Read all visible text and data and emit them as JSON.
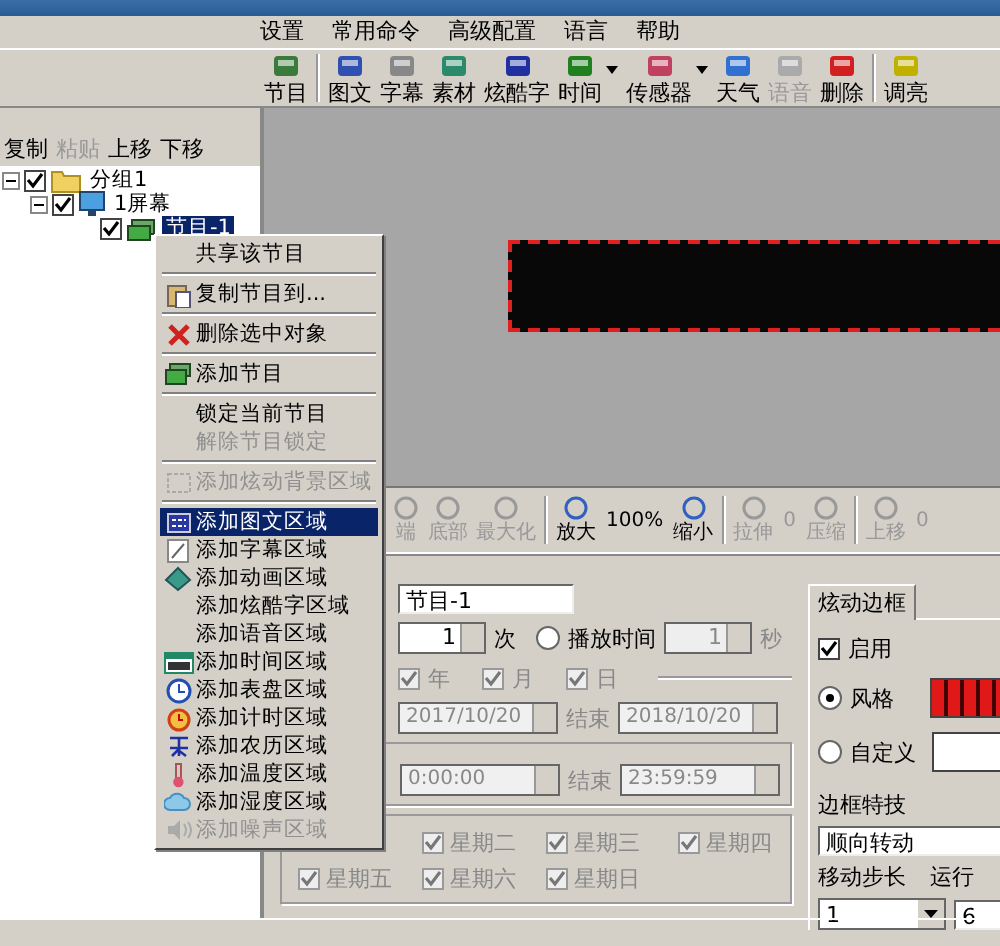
{
  "menu_bar": [
    "设置",
    "常用命令",
    "高级配置",
    "语言",
    "帮助"
  ],
  "toolbar": [
    {
      "label": "节目",
      "disabled": false,
      "dropdown": false
    },
    {
      "label": "图文",
      "disabled": false,
      "dropdown": false
    },
    {
      "label": "字幕",
      "disabled": false,
      "dropdown": false
    },
    {
      "label": "素材",
      "disabled": false,
      "dropdown": false
    },
    {
      "label": "炫酷字",
      "disabled": false,
      "dropdown": false
    },
    {
      "label": "时间",
      "disabled": false,
      "dropdown": true
    },
    {
      "label": "传感器",
      "disabled": false,
      "dropdown": true
    },
    {
      "label": "天气",
      "disabled": false,
      "dropdown": false
    },
    {
      "label": "语音",
      "disabled": true,
      "dropdown": false
    },
    {
      "label": "删除",
      "disabled": false,
      "dropdown": false
    },
    {
      "label": "调亮",
      "disabled": false,
      "dropdown": false
    }
  ],
  "tree_toolbar": [
    {
      "label": "复制",
      "disabled": false
    },
    {
      "label": "粘贴",
      "disabled": true
    },
    {
      "label": "上移",
      "disabled": false
    },
    {
      "label": "下移",
      "disabled": false
    }
  ],
  "tree": [
    {
      "label": "分组1",
      "kind": "group",
      "checked": true,
      "expanded": true,
      "selected": false,
      "children": [
        {
          "label": "1屏幕",
          "kind": "screen",
          "checked": true,
          "expanded": true,
          "selected": false,
          "children": [
            {
              "label": "节目-1",
              "kind": "program",
              "checked": true,
              "selected": true
            }
          ]
        }
      ]
    }
  ],
  "context_menu": [
    {
      "kind": "item",
      "label": "共享该节目",
      "disabled": false,
      "selected": false
    },
    {
      "kind": "separator"
    },
    {
      "kind": "item",
      "label": "复制节目到...",
      "disabled": false,
      "selected": false
    },
    {
      "kind": "separator"
    },
    {
      "kind": "item",
      "label": "删除选中对象",
      "disabled": false,
      "selected": false
    },
    {
      "kind": "separator"
    },
    {
      "kind": "item",
      "label": "添加节目",
      "disabled": false,
      "selected": false
    },
    {
      "kind": "separator"
    },
    {
      "kind": "item",
      "label": "锁定当前节目",
      "disabled": false,
      "selected": false
    },
    {
      "kind": "item",
      "label": "解除节目锁定",
      "disabled": true,
      "selected": false
    },
    {
      "kind": "separator"
    },
    {
      "kind": "item",
      "label": "添加炫动背景区域",
      "disabled": true,
      "selected": false
    },
    {
      "kind": "separator"
    },
    {
      "kind": "item",
      "label": "添加图文区域",
      "disabled": false,
      "selected": true
    },
    {
      "kind": "item",
      "label": "添加字幕区域",
      "disabled": false,
      "selected": false
    },
    {
      "kind": "item",
      "label": "添加动画区域",
      "disabled": false,
      "selected": false
    },
    {
      "kind": "item",
      "label": "添加炫酷字区域",
      "disabled": false,
      "selected": false
    },
    {
      "kind": "item",
      "label": "添加语音区域",
      "disabled": false,
      "selected": false
    },
    {
      "kind": "item",
      "label": "添加时间区域",
      "disabled": false,
      "selected": false
    },
    {
      "kind": "item",
      "label": "添加表盘区域",
      "disabled": false,
      "selected": false
    },
    {
      "kind": "item",
      "label": "添加计时区域",
      "disabled": false,
      "selected": false
    },
    {
      "kind": "item",
      "label": "添加农历区域",
      "disabled": false,
      "selected": false
    },
    {
      "kind": "item",
      "label": "添加温度区域",
      "disabled": false,
      "selected": false
    },
    {
      "kind": "item",
      "label": "添加湿度区域",
      "disabled": false,
      "selected": false
    },
    {
      "kind": "item",
      "label": "添加噪声区域",
      "disabled": true,
      "selected": false
    }
  ],
  "view_toolbar": [
    {
      "kind": "button",
      "label": "端",
      "disabled": true
    },
    {
      "kind": "button",
      "label": "底部",
      "disabled": true
    },
    {
      "kind": "button",
      "label": "最大化",
      "disabled": true
    },
    {
      "kind": "separator"
    },
    {
      "kind": "button",
      "label": "放大",
      "disabled": false
    },
    {
      "kind": "value",
      "label": "100%",
      "disabled": false
    },
    {
      "kind": "button",
      "label": "缩小",
      "disabled": false
    },
    {
      "kind": "separator"
    },
    {
      "kind": "button",
      "label": "拉伸",
      "disabled": true
    },
    {
      "kind": "value",
      "label": "0",
      "disabled": true
    },
    {
      "kind": "button",
      "label": "压缩",
      "disabled": true
    },
    {
      "kind": "separator"
    },
    {
      "kind": "button",
      "label": "上移",
      "disabled": true
    },
    {
      "kind": "value",
      "label": "0",
      "disabled": true
    }
  ],
  "program_form": {
    "name": "节目-1",
    "play_count": "1",
    "count_unit": "次",
    "play_time_radio": {
      "label": "播放时间",
      "selected": false
    },
    "play_time": "1",
    "time_unit": "秒",
    "schedule_disabled": true,
    "date_checks": [
      {
        "label": "年",
        "checked": true
      },
      {
        "label": "月",
        "checked": true
      },
      {
        "label": "日",
        "checked": true
      }
    ],
    "date_start": "2017/10/20",
    "date_end_label": "结束",
    "date_end": "2018/10/20",
    "time_start": "0:00:00",
    "time_end_label": "结束",
    "time_end": "23:59:59",
    "weekdays": [
      {
        "label": "星期二",
        "checked": true
      },
      {
        "label": "星期三",
        "checked": true
      },
      {
        "label": "星期四",
        "checked": true
      },
      {
        "label": "星期五",
        "checked": true
      },
      {
        "label": "星期六",
        "checked": true
      },
      {
        "label": "星期日",
        "checked": true
      }
    ]
  },
  "border_panel": {
    "tab": "炫动边框",
    "enable": {
      "label": "启用",
      "checked": true
    },
    "options": [
      {
        "label": "风格",
        "selected": true
      },
      {
        "label": "自定义",
        "selected": false
      }
    ],
    "effect_label": "边框特技",
    "effect": "顺向转动",
    "step_label": "移动步长",
    "step": "1",
    "speed_label": "运行",
    "speed": "6"
  }
}
